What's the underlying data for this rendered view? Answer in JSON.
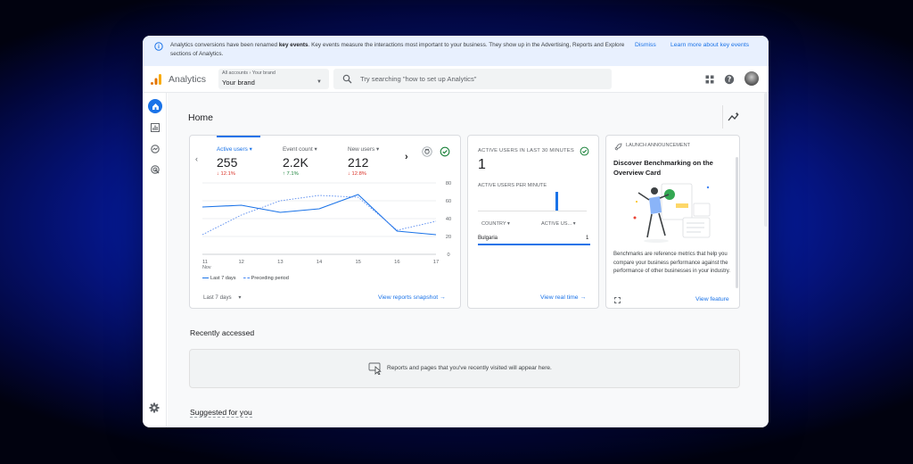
{
  "banner": {
    "text_pre": "Analytics conversions have been renamed ",
    "text_bold": "key events",
    "text_post": ". Key events measure the interactions most important to your business. They show up in the Advertising, Reports and Explore sections of Analytics.",
    "dismiss_label": "Dismiss",
    "learn_label": "Learn more about key events"
  },
  "header": {
    "app_name": "Analytics",
    "account_crumb": "All accounts › Your brand",
    "property": "Your brand",
    "search_placeholder": "Try searching \"how to set up Analytics\""
  },
  "page": {
    "title": "Home"
  },
  "overview": {
    "metrics": [
      {
        "label": "Active users",
        "value": "255",
        "delta": "↓ 12.1%",
        "trend": "down"
      },
      {
        "label": "Event count",
        "value": "2.2K",
        "delta": "↑ 7.1%",
        "trend": "up"
      },
      {
        "label": "New users",
        "value": "212",
        "delta": "↓ 12.8%",
        "trend": "down"
      }
    ],
    "legend_current": "Last 7 days",
    "legend_previous": "Preceding period",
    "date_range": "Last 7 days",
    "link": "View reports snapshot"
  },
  "chart_data": {
    "type": "line",
    "x": [
      "11",
      "12",
      "13",
      "14",
      "15",
      "16",
      "17"
    ],
    "x_sublabel": "Nov",
    "series": [
      {
        "name": "Last 7 days",
        "values": [
          53,
          55,
          47,
          51,
          67,
          26,
          22
        ]
      },
      {
        "name": "Preceding period",
        "values": [
          22,
          44,
          60,
          66,
          64,
          27,
          37
        ]
      }
    ],
    "yticks": [
      0,
      20,
      40,
      60,
      80
    ],
    "ylim": [
      0,
      80
    ],
    "legend": "bottom-left",
    "grid": true
  },
  "realtime": {
    "title": "ACTIVE USERS IN LAST 30 MINUTES",
    "value": "1",
    "per_minute": "ACTIVE USERS PER MINUTE",
    "col_country": "COUNTRY ▾",
    "col_users": "ACTIVE US... ▾",
    "row_country": "Bulgaria",
    "row_value": "1",
    "link": "View real time"
  },
  "announcement": {
    "head": "LAUNCH ANNOUNCEMENT",
    "title": "Discover Benchmarking on the Overview Card",
    "body": "Benchmarks are reference metrics that help you compare your business performance against the performance of other businesses in your industry.",
    "link": "View feature"
  },
  "recent": {
    "title": "Recently accessed",
    "empty_text": "Reports and pages that you've recently visited will appear here."
  },
  "suggested": {
    "title": "Suggested for you"
  },
  "colors": {
    "accent": "#1a73e8",
    "banner": "#e8f0fe",
    "down": "#d93025",
    "up": "#188038"
  }
}
